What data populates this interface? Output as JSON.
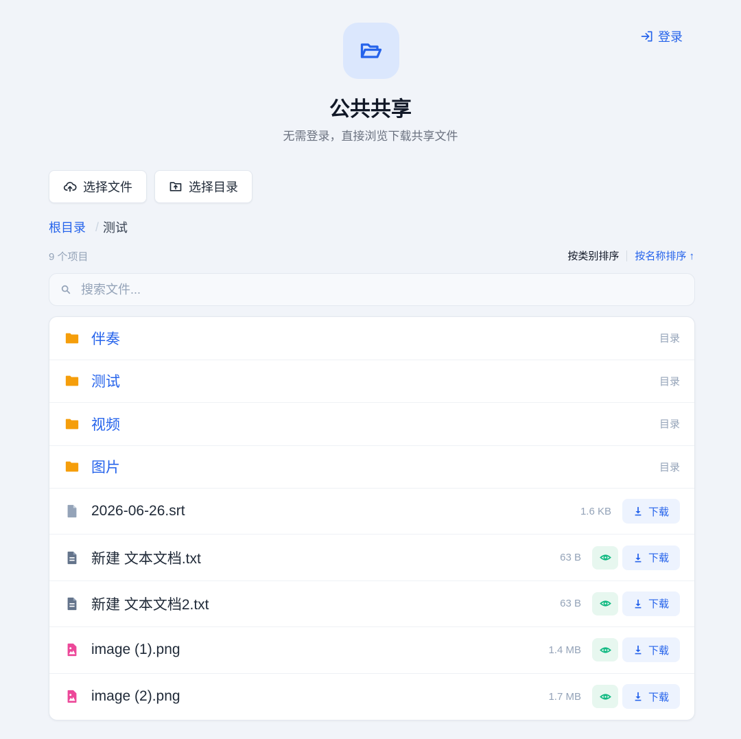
{
  "header": {
    "login_label": "登录",
    "title": "公共共享",
    "subtitle": "无需登录，直接浏览下载共享文件"
  },
  "actions": {
    "select_files": "选择文件",
    "select_dir": "选择目录"
  },
  "breadcrumb": {
    "root": "根目录",
    "separator": "/",
    "current": "测试"
  },
  "toolbar": {
    "item_count": "9 个项目",
    "sort_by_category": "按类别排序",
    "sort_by_name": "按名称排序 ↑"
  },
  "search": {
    "placeholder": "搜索文件..."
  },
  "directories": [
    {
      "name": "伴奏",
      "type": "目录"
    },
    {
      "name": "测试",
      "type": "目录"
    },
    {
      "name": "视频",
      "type": "目录"
    },
    {
      "name": "图片",
      "type": "目录"
    }
  ],
  "files": [
    {
      "name": "2026-06-26.srt",
      "size": "1.6 KB",
      "icon": "generic-file-icon",
      "previewable": false,
      "download_label": "下载"
    },
    {
      "name": "新建 文本文档.txt",
      "size": "63 B",
      "icon": "text-file-icon",
      "previewable": true,
      "download_label": "下载"
    },
    {
      "name": "新建 文本文档2.txt",
      "size": "63 B",
      "icon": "text-file-icon",
      "previewable": true,
      "download_label": "下载"
    },
    {
      "name": "image (1).png",
      "size": "1.4 MB",
      "icon": "image-file-icon",
      "previewable": true,
      "download_label": "下载"
    },
    {
      "name": "image (2).png",
      "size": "1.7 MB",
      "icon": "image-file-icon",
      "previewable": true,
      "download_label": "下载"
    }
  ],
  "colors": {
    "accent": "#2563eb",
    "folder": "#f59e0b",
    "text_file": "#64748b",
    "generic_file": "#94a3b8",
    "image_file": "#ec4899",
    "preview": "#10b981"
  }
}
